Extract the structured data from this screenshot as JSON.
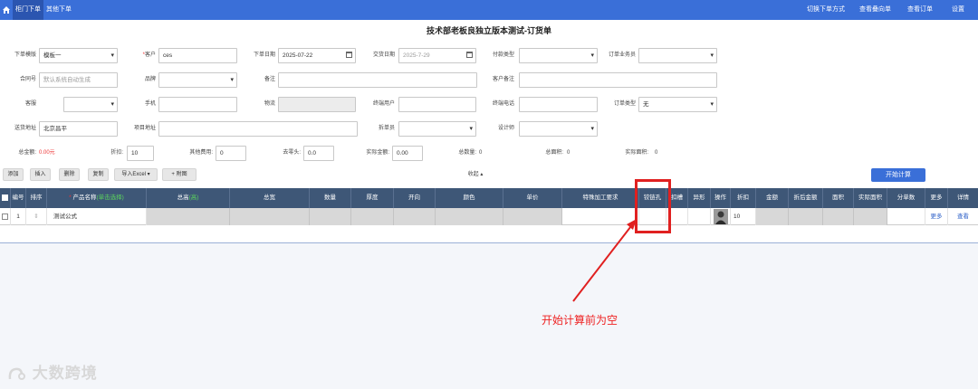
{
  "nav": {
    "tabs": [
      "柜门下单",
      "其他下单"
    ],
    "right_links": [
      "切换下单方式",
      "查看叠向单",
      "查看订单",
      "设置"
    ]
  },
  "title": "技术部老板良独立版本测试-订货单",
  "form": {
    "template_label": "下单模版",
    "template_value": "模板一",
    "customer_label": "*客户",
    "customer_value": "ces",
    "order_date_label": "下单日期",
    "order_date_value": "2025-07-22",
    "delivery_date_label": "交货日期",
    "delivery_date_value": "2025-7-29",
    "payment_type_label": "付款类型",
    "salesman_label": "订单业务员",
    "contract_label": "合同号",
    "contract_placeholder": "默认系统自动生成",
    "brand_label": "品牌",
    "remark_label": "备注",
    "customer_remark_label": "客户备注",
    "service_label": "客服",
    "mobile_label": "手机",
    "logistics_label": "物流",
    "end_user_label": "终端用户",
    "end_phone_label": "终端电话",
    "order_type_label": "订单类型",
    "order_type_value": "无",
    "address_label": "送货地址",
    "address_value": "北京昌平",
    "project_address_label": "项目地址",
    "disassembler_label": "拆单员",
    "designer_label": "设计师",
    "total_amount_label": "总金额:",
    "total_amount_value": "0.00元",
    "discount_label": "折扣:",
    "discount_value": "10",
    "other_fee_label": "其他费用:",
    "other_fee_value": "0",
    "rounding_label": "去零头:",
    "rounding_value": "0.0",
    "actual_amount_label": "实际金额:",
    "actual_amount_value": "0.00",
    "total_qty_label": "总数量:",
    "total_qty_value": "0",
    "total_area_label": "总面积:",
    "total_area_value": "0",
    "actual_area_label": "实际面积:",
    "actual_area_value": "0"
  },
  "toolbar": {
    "add": "添加",
    "insert": "插入",
    "delete": "删除",
    "copy": "复制",
    "import_excel": "导入Excel ▾",
    "attach": "+ 附图",
    "collapse": "收起 ▴",
    "start_calc": "开始计算"
  },
  "table": {
    "headers": [
      "编号",
      "排序",
      "产品名称",
      "总高",
      "总宽",
      "数量",
      "厚度",
      "开向",
      "颜色",
      "单价",
      "特殊加工要求",
      "铰链孔",
      "扣槽",
      "异形",
      "操作",
      "折扣",
      "金额",
      "折后金额",
      "面积",
      "实际面积",
      "分单数",
      "更多",
      "详情"
    ],
    "product_sub": "(单击选择)",
    "height_sub": "(高)",
    "row": {
      "no": "1",
      "product": "测试公式",
      "discount": "10",
      "more": "更多",
      "detail": "查看"
    }
  },
  "annotation": {
    "note": "开始计算前为空",
    "color": "#e02020"
  },
  "watermark": "大数跨境"
}
